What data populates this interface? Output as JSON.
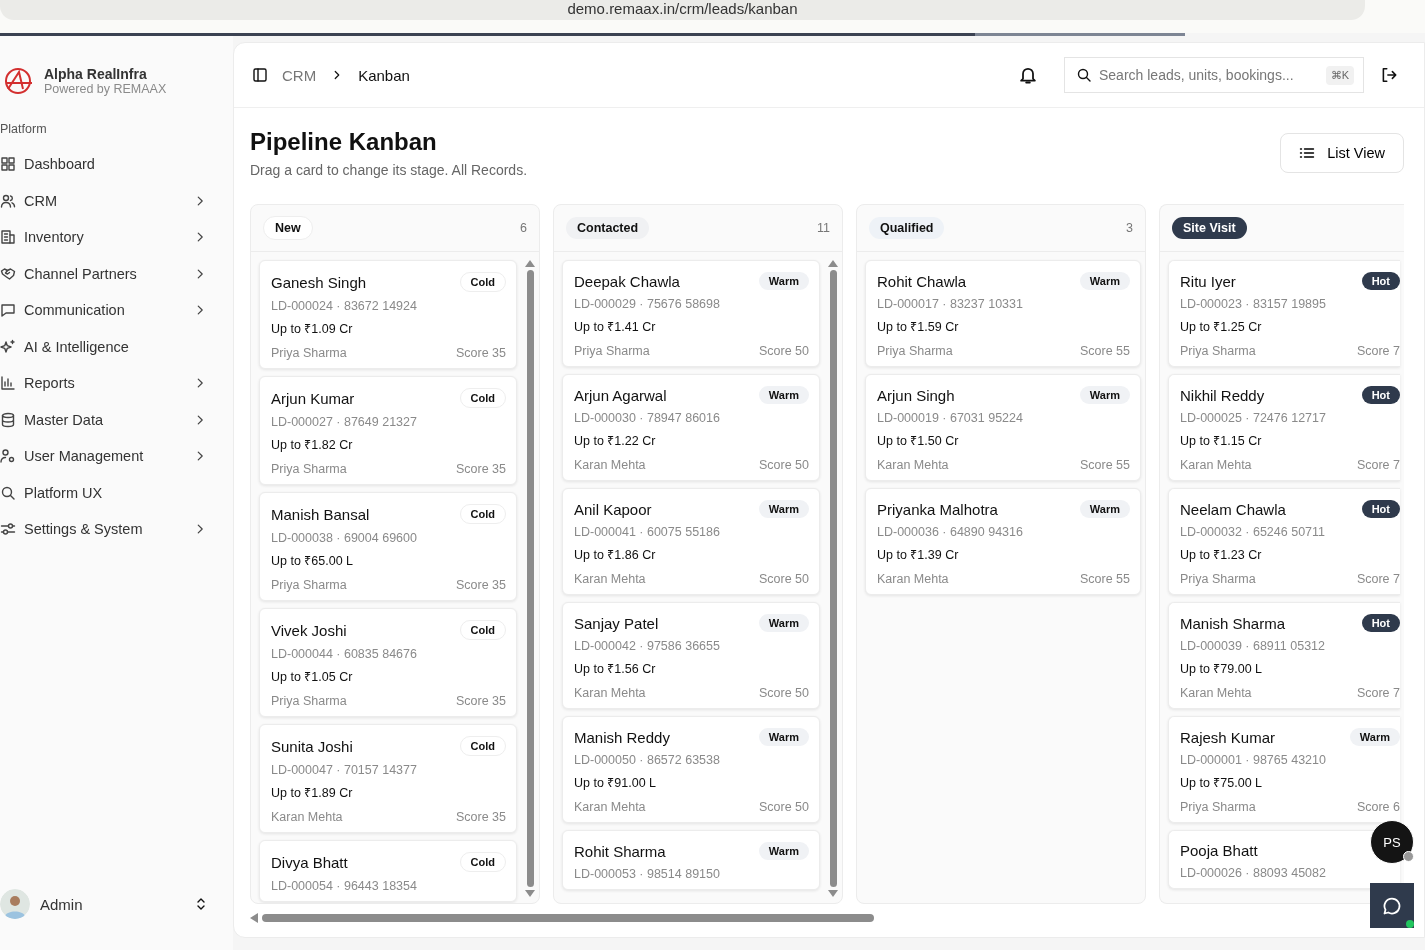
{
  "browser": {
    "url": "demo.remaax.in/crm/leads/kanban"
  },
  "sidebar": {
    "brand": "Alpha RealInfra",
    "tagline": "Powered by REMAAX",
    "section": "Platform",
    "items": [
      {
        "label": "Dashboard",
        "expandable": false
      },
      {
        "label": "CRM",
        "expandable": true
      },
      {
        "label": "Inventory",
        "expandable": true
      },
      {
        "label": "Channel Partners",
        "expandable": true
      },
      {
        "label": "Communication",
        "expandable": true
      },
      {
        "label": "AI & Intelligence",
        "expandable": false
      },
      {
        "label": "Reports",
        "expandable": true
      },
      {
        "label": "Master Data",
        "expandable": true
      },
      {
        "label": "User Management",
        "expandable": true
      },
      {
        "label": "Platform UX",
        "expandable": false
      },
      {
        "label": "Settings & System",
        "expandable": true
      }
    ],
    "user": {
      "name": "Admin"
    }
  },
  "header": {
    "breadcrumb": [
      "CRM",
      "Kanban"
    ],
    "search": {
      "placeholder": "Search leads, units, bookings...",
      "shortcut": "⌘K"
    }
  },
  "page": {
    "title": "Pipeline Kanban",
    "subtitle": "Drag a card to change its stage. All Records.",
    "list_view_button": "List View"
  },
  "columns": [
    {
      "title": "New",
      "kind": "outline",
      "count": "6",
      "cards": [
        {
          "name": "Ganesh Singh",
          "tag": {
            "label": "Cold",
            "kind": "cold"
          },
          "ref": "LD-000024 · 83672 14924",
          "budget": "Up to ₹1.09 Cr",
          "owner": "Priya Sharma",
          "score": "Score 35"
        },
        {
          "name": "Arjun Kumar",
          "tag": {
            "label": "Cold",
            "kind": "cold"
          },
          "ref": "LD-000027 · 87649 21327",
          "budget": "Up to ₹1.82 Cr",
          "owner": "Priya Sharma",
          "score": "Score 35"
        },
        {
          "name": "Manish Bansal",
          "tag": {
            "label": "Cold",
            "kind": "cold"
          },
          "ref": "LD-000038 · 69004 69600",
          "budget": "Up to ₹65.00 L",
          "owner": "Priya Sharma",
          "score": "Score 35"
        },
        {
          "name": "Vivek Joshi",
          "tag": {
            "label": "Cold",
            "kind": "cold"
          },
          "ref": "LD-000044 · 60835 84676",
          "budget": "Up to ₹1.05 Cr",
          "owner": "Priya Sharma",
          "score": "Score 35"
        },
        {
          "name": "Sunita Joshi",
          "tag": {
            "label": "Cold",
            "kind": "cold"
          },
          "ref": "LD-000047 · 70157 14377",
          "budget": "Up to ₹1.89 Cr",
          "owner": "Karan Mehta",
          "score": "Score 35"
        },
        {
          "name": "Divya Bhatt",
          "tag": {
            "label": "Cold",
            "kind": "cold"
          },
          "ref": "LD-000054 · 96443 18354"
        }
      ]
    },
    {
      "title": "Contacted",
      "kind": "soft",
      "count": "11",
      "cards": [
        {
          "name": "Deepak Chawla",
          "tag": {
            "label": "Warm",
            "kind": "warm"
          },
          "ref": "LD-000029 · 75676 58698",
          "budget": "Up to ₹1.41 Cr",
          "owner": "Priya Sharma",
          "score": "Score 50"
        },
        {
          "name": "Arjun Agarwal",
          "tag": {
            "label": "Warm",
            "kind": "warm"
          },
          "ref": "LD-000030 · 78947 86016",
          "budget": "Up to ₹1.22 Cr",
          "owner": "Karan Mehta",
          "score": "Score 50"
        },
        {
          "name": "Anil Kapoor",
          "tag": {
            "label": "Warm",
            "kind": "warm"
          },
          "ref": "LD-000041 · 60075 55186",
          "budget": "Up to ₹1.86 Cr",
          "owner": "Karan Mehta",
          "score": "Score 50"
        },
        {
          "name": "Sanjay Patel",
          "tag": {
            "label": "Warm",
            "kind": "warm"
          },
          "ref": "LD-000042 · 97586 36655",
          "budget": "Up to ₹1.56 Cr",
          "owner": "Karan Mehta",
          "score": "Score 50"
        },
        {
          "name": "Manish Reddy",
          "tag": {
            "label": "Warm",
            "kind": "warm"
          },
          "ref": "LD-000050 · 86572 63538",
          "budget": "Up to ₹91.00 L",
          "owner": "Karan Mehta",
          "score": "Score 50"
        },
        {
          "name": "Rohit Sharma",
          "tag": {
            "label": "Warm",
            "kind": "warm"
          },
          "ref": "LD-000053 · 98514 89150"
        }
      ]
    },
    {
      "title": "Qualified",
      "kind": "tint",
      "count": "3",
      "cards": [
        {
          "name": "Rohit Chawla",
          "tag": {
            "label": "Warm",
            "kind": "warm"
          },
          "ref": "LD-000017 · 83237 10331",
          "budget": "Up to ₹1.59 Cr",
          "owner": "Priya Sharma",
          "score": "Score 55"
        },
        {
          "name": "Arjun Singh",
          "tag": {
            "label": "Warm",
            "kind": "warm"
          },
          "ref": "LD-000019 · 67031 95224",
          "budget": "Up to ₹1.50 Cr",
          "owner": "Karan Mehta",
          "score": "Score 55"
        },
        {
          "name": "Priyanka Malhotra",
          "tag": {
            "label": "Warm",
            "kind": "warm"
          },
          "ref": "LD-000036 · 64890 94316",
          "budget": "Up to ₹1.39 Cr",
          "owner": "Karan Mehta",
          "score": "Score 55"
        }
      ]
    },
    {
      "title": "Site Visit",
      "kind": "dark",
      "cards": [
        {
          "name": "Ritu Iyer",
          "tag": {
            "label": "Hot",
            "kind": "hot"
          },
          "ref": "LD-000023 · 83157 19895",
          "budget": "Up to ₹1.25 Cr",
          "owner": "Priya Sharma",
          "score": "Score 7"
        },
        {
          "name": "Nikhil Reddy",
          "tag": {
            "label": "Hot",
            "kind": "hot"
          },
          "ref": "LD-000025 · 72476 12717",
          "budget": "Up to ₹1.15 Cr",
          "owner": "Karan Mehta",
          "score": "Score 7"
        },
        {
          "name": "Neelam Chawla",
          "tag": {
            "label": "Hot",
            "kind": "hot"
          },
          "ref": "LD-000032 · 65246 50711",
          "budget": "Up to ₹1.23 Cr",
          "owner": "Priya Sharma",
          "score": "Score 7"
        },
        {
          "name": "Manish Sharma",
          "tag": {
            "label": "Hot",
            "kind": "hot"
          },
          "ref": "LD-000039 · 68911 05312",
          "budget": "Up to ₹79.00 L",
          "owner": "Karan Mehta",
          "score": "Score 7"
        },
        {
          "name": "Rajesh Kumar",
          "tag": {
            "label": "Warm",
            "kind": "warm"
          },
          "ref": "LD-000001 · 98765 43210",
          "budget": "Up to ₹75.00 L",
          "owner": "Priya Sharma",
          "score": "Score 6"
        },
        {
          "name": "Pooja Bhatt",
          "ref": "LD-000026 · 88093 45082"
        }
      ]
    }
  ],
  "presence": {
    "initials": "PS"
  }
}
